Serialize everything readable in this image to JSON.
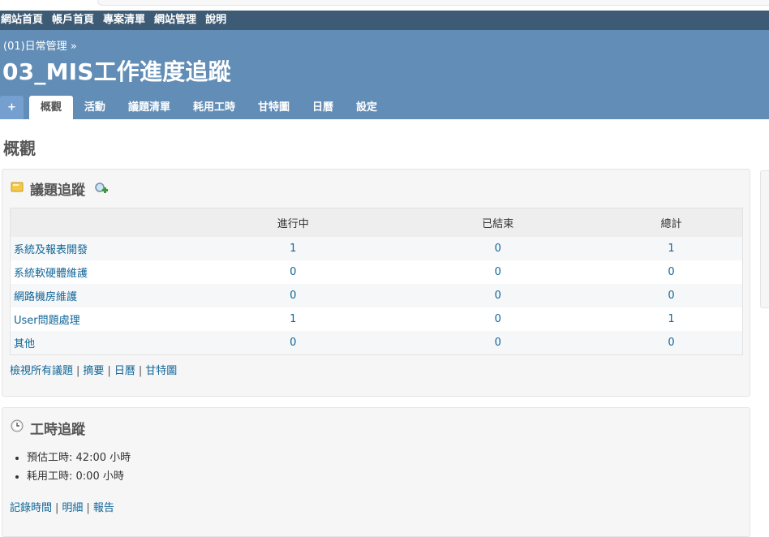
{
  "top_menu": [
    "網站首頁",
    "帳戶首頁",
    "專案清單",
    "網站管理",
    "說明"
  ],
  "header": {
    "breadcrumb": "(01)日常管理",
    "breadcrumb_sep": " »",
    "title": "03_MIS工作進度追蹤"
  },
  "tabs": {
    "new": "+",
    "items": [
      "概觀",
      "活動",
      "議題清單",
      "耗用工時",
      "甘特圖",
      "日曆",
      "設定"
    ]
  },
  "page_title": "概觀",
  "issue_tracking": {
    "title": "議題追蹤",
    "columns": [
      "",
      "進行中",
      "已結束",
      "總計"
    ],
    "rows": [
      {
        "name": "系統及報表開發",
        "open": "1",
        "closed": "0",
        "total": "1"
      },
      {
        "name": "系統軟硬體維護",
        "open": "0",
        "closed": "0",
        "total": "0"
      },
      {
        "name": "網路機房維護",
        "open": "0",
        "closed": "0",
        "total": "0"
      },
      {
        "name": "User問題處理",
        "open": "1",
        "closed": "0",
        "total": "1"
      },
      {
        "name": "其他",
        "open": "0",
        "closed": "0",
        "total": "0"
      }
    ],
    "links": [
      "檢視所有議題",
      "摘要",
      "日曆",
      "甘特圖"
    ],
    "separator": "|"
  },
  "time_tracking": {
    "title": "工時追蹤",
    "estimated_label": "預估工時:",
    "estimated_value": "42:00",
    "spent_label": "耗用工時:",
    "spent_value": "0:00",
    "unit": "小時",
    "links": [
      "記錄時間",
      "明細",
      "報告"
    ],
    "separator": "|"
  },
  "colors": {
    "top_bar": "#3e5b76",
    "header": "#628db6",
    "link": "#116699"
  },
  "icons": [
    "issues-icon",
    "search-add-icon",
    "clock-icon"
  ]
}
